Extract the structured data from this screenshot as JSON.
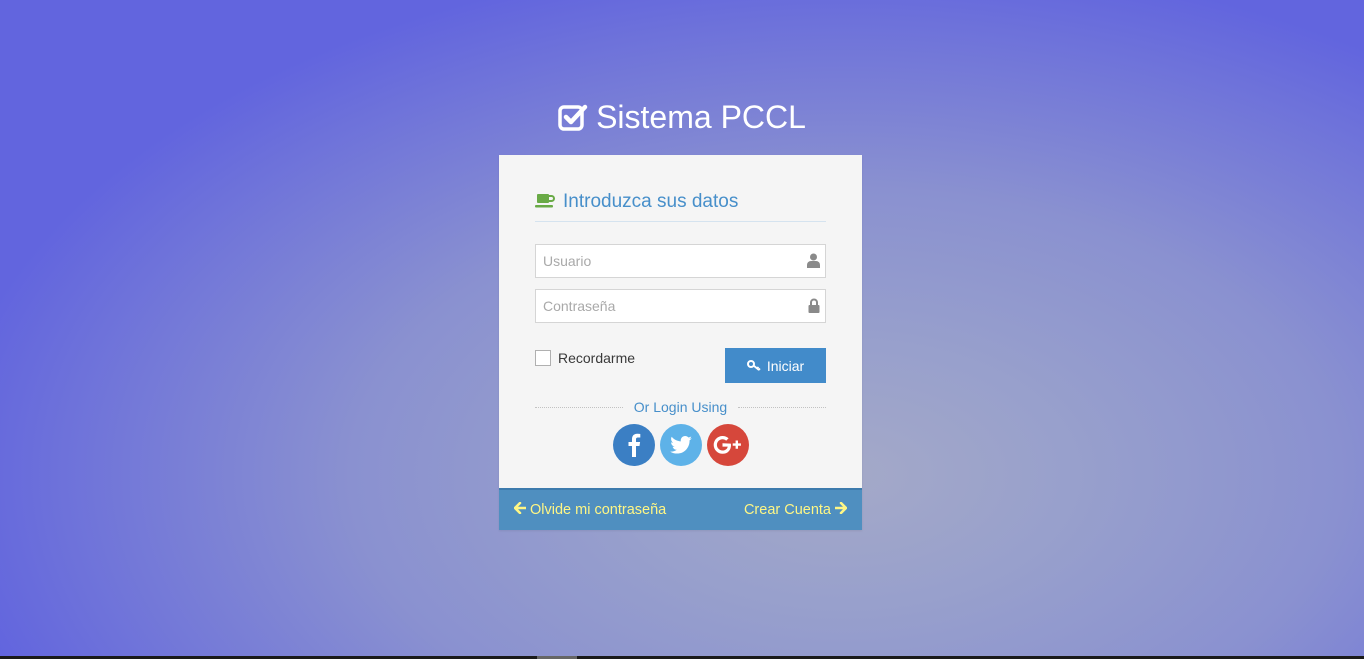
{
  "brand": {
    "title": "Sistema PCCL",
    "icon": "check-square-icon"
  },
  "login_box": {
    "heading": "Introduzca sus datos",
    "heading_icon": "coffee-icon",
    "username": {
      "placeholder": "Usuario",
      "value": "",
      "icon": "user-icon"
    },
    "password": {
      "placeholder": "Contraseña",
      "value": "",
      "icon": "lock-icon"
    },
    "remember_label": "Recordarme",
    "remember_checked": false,
    "login_button": "Iniciar",
    "divider_text": "Or Login Using",
    "socials": [
      "facebook-icon",
      "twitter-icon",
      "google-plus-icon"
    ]
  },
  "toolbar": {
    "forgot_link": "Olvide mi contraseña",
    "create_link": "Crear Cuenta"
  },
  "colors": {
    "accent": "#428bca",
    "heading": "#478fca",
    "toolbar": "#4f8fc0",
    "link_yellow": "#fef685",
    "facebook": "#3b7fc4",
    "twitter": "#5eb2e8",
    "google": "#d6473b",
    "cup_green": "#69aa46"
  }
}
